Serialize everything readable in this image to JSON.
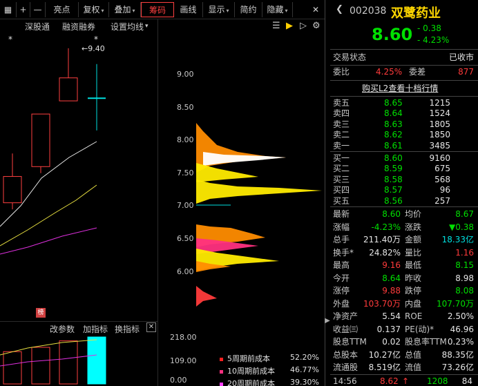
{
  "toolbar": {
    "grid_icon": "▦",
    "plus": "+",
    "minus": "—",
    "items": [
      {
        "label": "亮点",
        "caret": false
      },
      {
        "label": "复权",
        "caret": true
      },
      {
        "label": "叠加",
        "caret": true
      },
      {
        "label": "筹码",
        "caret": false,
        "active": true
      },
      {
        "label": "画线",
        "caret": false
      },
      {
        "label": "显示",
        "caret": true
      },
      {
        "label": "简约",
        "caret": false
      },
      {
        "label": "隐藏",
        "caret": true
      }
    ],
    "close_icon": "✕"
  },
  "subbar": {
    "shen_gu_tong": "深股通",
    "margin": "融资融券",
    "ma_settings": "设置均线",
    "ma_caret": "▾"
  },
  "chart": {
    "star_markers": [
      "*",
      "*"
    ],
    "high_annotation": "9.40",
    "bang_badge": "榜",
    "price_axis": [
      "9.00",
      "8.50",
      "8.00",
      "7.50",
      "7.00",
      "6.50",
      "6.00"
    ],
    "candles": [
      {
        "open": 7.05,
        "close": 7.45,
        "high": 7.8,
        "low": 6.95
      },
      {
        "open": 7.6,
        "close": 8.4,
        "high": 8.4,
        "low": 7.5
      },
      {
        "open": 8.6,
        "close": 8.95,
        "high": 9.4,
        "low": 8.6
      },
      {
        "open": 8.64,
        "close": 8.6,
        "high": 9.16,
        "low": 8.15
      }
    ],
    "volume_axis": [
      "218.00",
      "109.00",
      "0.00"
    ],
    "volume_values": [
      150,
      170,
      200,
      218
    ],
    "lower_tabs": [
      "改参数",
      "加指标",
      "换指标"
    ],
    "lower_close": "✕"
  },
  "chips": {
    "legend": [
      {
        "label": "5周期前成本",
        "pct": "52.20%",
        "color": "#ff2020"
      },
      {
        "label": "10周期前成本",
        "pct": "46.77%",
        "color": "#ff3080"
      },
      {
        "label": "20周期前成本",
        "pct": "39.30%",
        "color": "#ff40ff"
      }
    ]
  },
  "quote": {
    "code": "002038",
    "name": "双鹭药业",
    "price": "8.60",
    "change": "- 0.38",
    "change_pct": "- 4.23%",
    "status_label": "交易状态",
    "status_value": "已收市",
    "weibi_label": "委比",
    "weibi_value": "4.25%",
    "weicha_label": "委差",
    "weicha_value": "877",
    "l2_link": "购买L2查看十档行情",
    "asks": [
      {
        "label": "卖五",
        "price": "8.65",
        "vol": "1215"
      },
      {
        "label": "卖四",
        "price": "8.64",
        "vol": "1524"
      },
      {
        "label": "卖三",
        "price": "8.63",
        "vol": "1805"
      },
      {
        "label": "卖二",
        "price": "8.62",
        "vol": "1850"
      },
      {
        "label": "卖一",
        "price": "8.61",
        "vol": "3485"
      }
    ],
    "bids": [
      {
        "label": "买一",
        "price": "8.60",
        "vol": "9160"
      },
      {
        "label": "买二",
        "price": "8.59",
        "vol": "675"
      },
      {
        "label": "买三",
        "price": "8.58",
        "vol": "568"
      },
      {
        "label": "买四",
        "price": "8.57",
        "vol": "96"
      },
      {
        "label": "买五",
        "price": "8.56",
        "vol": "257"
      }
    ],
    "stats": [
      {
        "l1": "最新",
        "v1": "8.60",
        "c1": "green",
        "l2": "均价",
        "v2": "8.67",
        "c2": "green"
      },
      {
        "l1": "涨幅",
        "v1": "-4.23%",
        "c1": "green",
        "l2": "涨跌",
        "v2": "▼0.38",
        "c2": "green"
      },
      {
        "l1": "总手",
        "v1": "211.40万",
        "c1": "white",
        "l2": "金额",
        "v2": "18.33亿",
        "c2": "cyan"
      },
      {
        "l1": "换手*",
        "v1": "24.82%",
        "c1": "white",
        "l2": "量比",
        "v2": "1.16",
        "c2": "red"
      },
      {
        "l1": "最高",
        "v1": "9.16",
        "c1": "red",
        "l2": "最低",
        "v2": "8.15",
        "c2": "green"
      },
      {
        "l1": "今开",
        "v1": "8.64",
        "c1": "green",
        "l2": "昨收",
        "v2": "8.98",
        "c2": "white"
      },
      {
        "l1": "涨停",
        "v1": "9.88",
        "c1": "red",
        "l2": "跌停",
        "v2": "8.08",
        "c2": "green"
      },
      {
        "l1": "外盘",
        "v1": "103.70万",
        "c1": "red",
        "l2": "内盘",
        "v2": "107.70万",
        "c2": "green"
      },
      {
        "l1": "净资产",
        "v1": "5.54",
        "c1": "white",
        "l2": "ROE",
        "v2": "2.50%",
        "c2": "white"
      },
      {
        "l1": "收益㈢",
        "v1": "0.137",
        "c1": "white",
        "l2": "PE(动)*",
        "v2": "46.96",
        "c2": "white"
      },
      {
        "l1": "股息TTM",
        "v1": "0.02",
        "c1": "white",
        "l2": "股息率TTM",
        "v2": "0.23%",
        "c2": "white"
      },
      {
        "l1": "总股本",
        "v1": "10.27亿",
        "c1": "white",
        "l2": "总值",
        "v2": "88.35亿",
        "c2": "white"
      },
      {
        "l1": "流通股",
        "v1": "8.519亿",
        "c1": "white",
        "l2": "流值",
        "v2": "73.26亿",
        "c2": "white"
      }
    ],
    "tick": {
      "time": "14:56",
      "price": "8.62",
      "arrow": "↑",
      "vol": "1208",
      "count": "84"
    }
  }
}
